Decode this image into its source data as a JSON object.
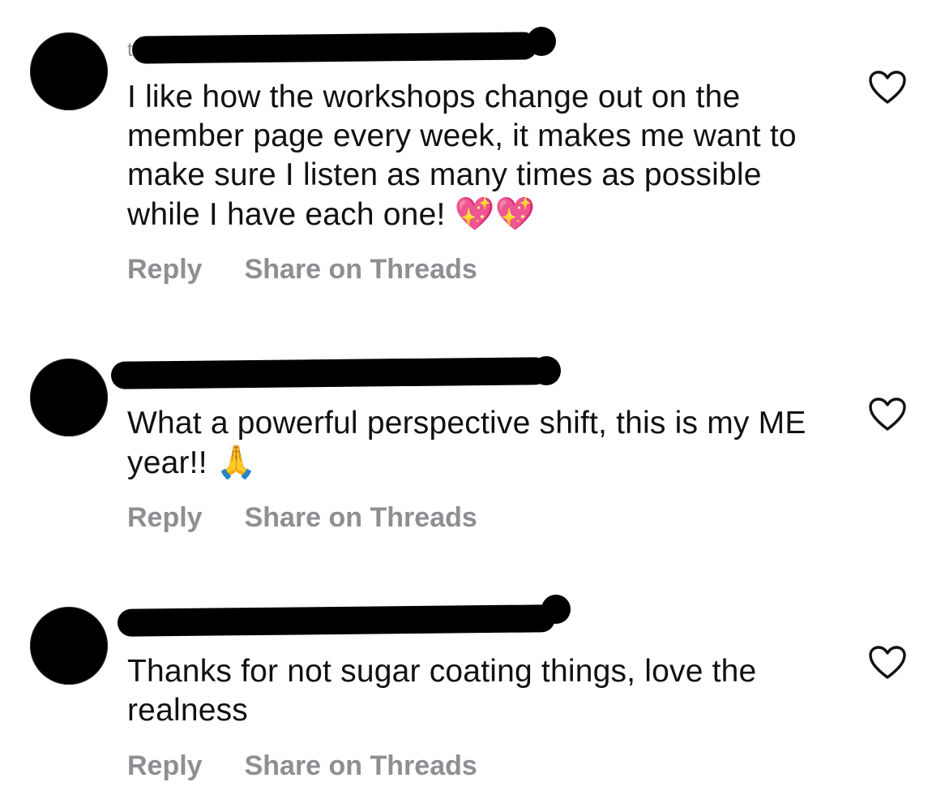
{
  "comments": [
    {
      "username_visible": "t",
      "text": "I like how the workshops change out on the member page every week, it makes me want to make sure I listen as many times as possible while I have each one! 💖💖",
      "text_main": "I like how the workshops change out on the member page every week, it makes me want to make sure I listen as many times as possible while I have each one!",
      "emoji": "💖💖",
      "reply_label": "Reply",
      "share_label": "Share on Threads",
      "like_icon": "heart-outline-icon"
    },
    {
      "username_visible": "",
      "text_main": "What a powerful perspective shift, this is my ME year!!",
      "emoji": "🙏",
      "reply_label": "Reply",
      "share_label": "Share on Threads",
      "like_icon": "heart-outline-icon"
    },
    {
      "username_visible": "",
      "text_main": "Thanks for not sugar coating things, love the realness",
      "emoji": "",
      "reply_label": "Reply",
      "share_label": "Share on Threads",
      "like_icon": "heart-outline-icon"
    }
  ],
  "colors": {
    "text": "#111111",
    "secondary": "#8e8e93",
    "redaction": "#000000",
    "background": "#ffffff"
  }
}
